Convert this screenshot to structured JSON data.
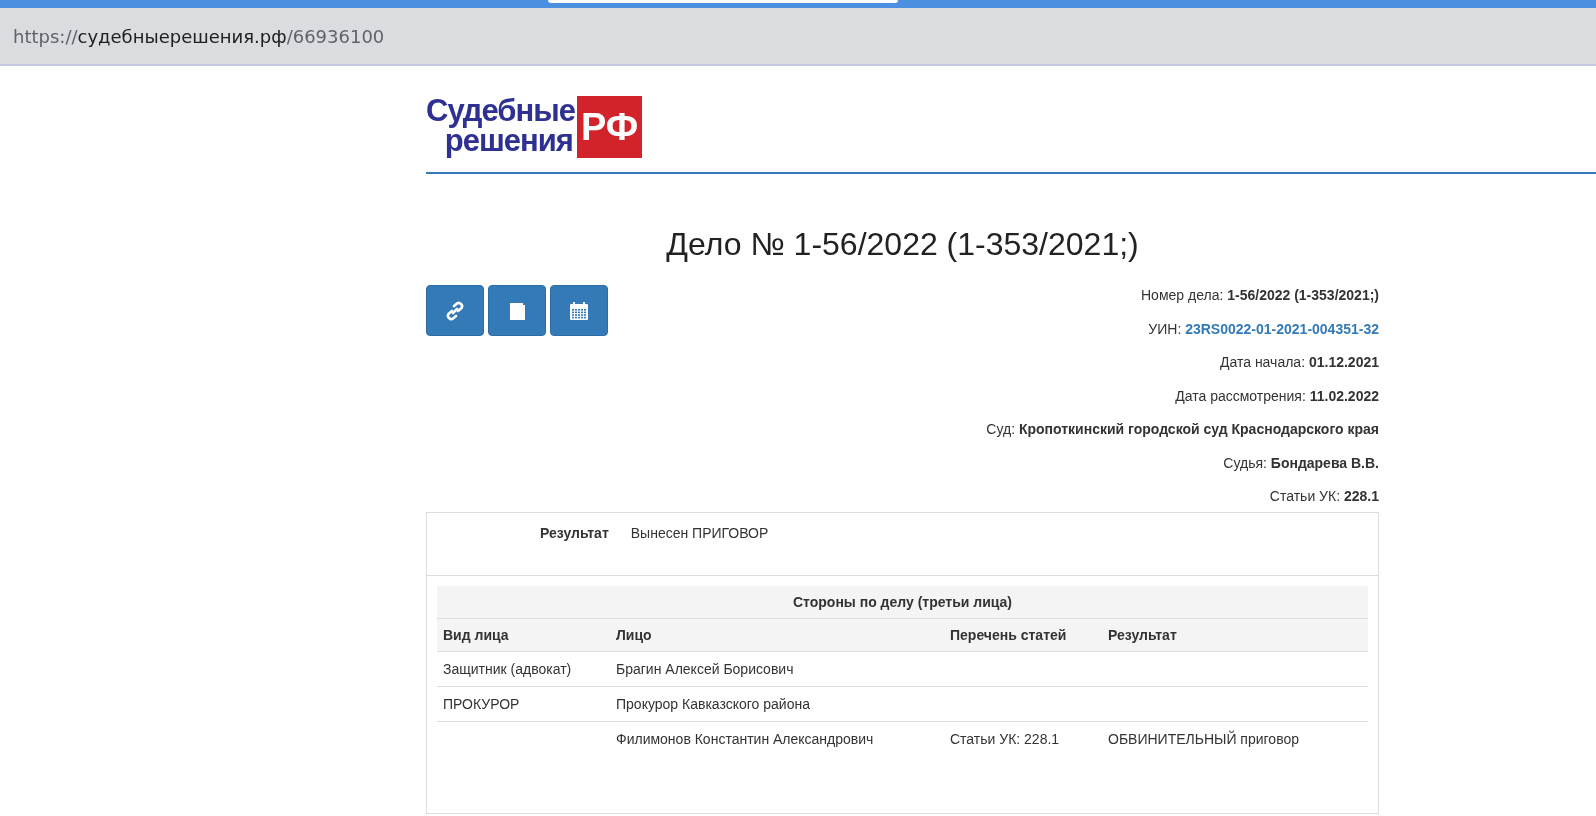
{
  "browser": {
    "url_scheme": "https://",
    "url_host": "судебныерешения.рф",
    "url_path": "/66936100"
  },
  "logo": {
    "line_1": "Судебные",
    "line_2": "решения",
    "badge": "РФ"
  },
  "title": "Дело № 1-56/2022 (1-353/2021;)",
  "details": [
    {
      "label": "Номер дела:",
      "value": "1-56/2022 (1-353/2021;)",
      "kind": "plain"
    },
    {
      "label": "УИН:",
      "value": "23RS0022-01-2021-004351-32",
      "kind": "link"
    },
    {
      "label": "Дата начала:",
      "value": "01.12.2021",
      "kind": "plain"
    },
    {
      "label": "Дата рассмотрения:",
      "value": "11.02.2022",
      "kind": "plain"
    },
    {
      "label": "Суд:",
      "value": "Кропоткинский городской суд Краснодарского края",
      "kind": "plain"
    },
    {
      "label": "Судья:",
      "value": "Бондарева В.В.",
      "kind": "plain"
    },
    {
      "label": "Статьи УК:",
      "value": "228.1",
      "kind": "plain"
    }
  ],
  "result": {
    "label": "Результат",
    "value": "Вынесен ПРИГОВОР"
  },
  "parties": {
    "caption": "Стороны по делу (третьи лица)",
    "columns": [
      "Вид лица",
      "Лицо",
      "Перечень статей",
      "Результат"
    ],
    "rows": [
      [
        "Защитник (адвокат)",
        "Брагин Алексей Борисович",
        "",
        ""
      ],
      [
        "ПРОКУРОР",
        "Прокурор Кавказского района",
        "",
        ""
      ],
      [
        "",
        "Филимонов Константин Александрович",
        "Статьи УК: 228.1",
        "ОБВИНИТЕЛЬНЫЙ приговор"
      ]
    ]
  }
}
